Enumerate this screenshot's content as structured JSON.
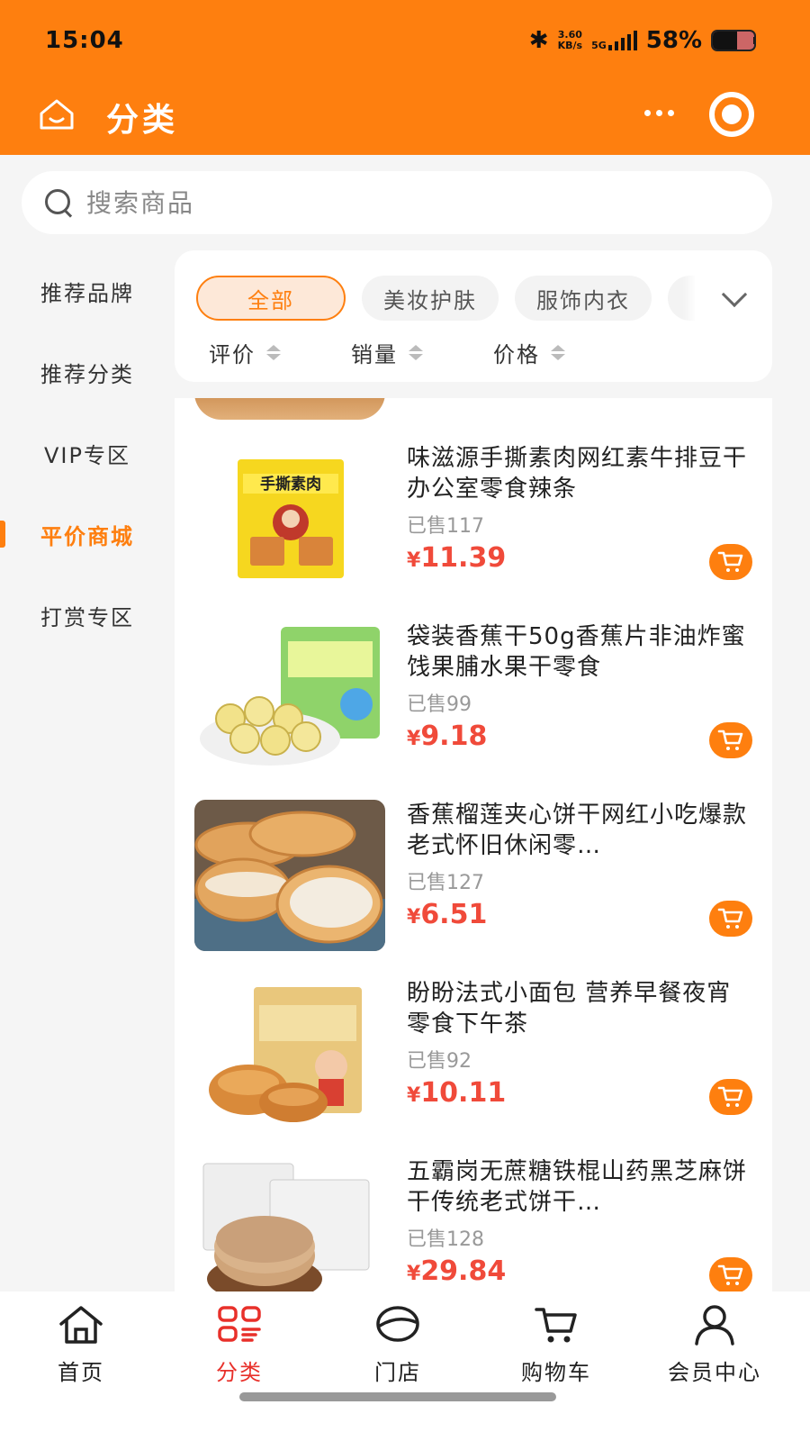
{
  "status_bar": {
    "time": "15:04",
    "network_speed_top": "3.60",
    "network_speed_bottom": "KB/s",
    "network_type": "5G",
    "battery_percent": "58%",
    "battery_level": 0.58
  },
  "header": {
    "title": "分类"
  },
  "search": {
    "placeholder": "搜索商品"
  },
  "sidebar": {
    "items": [
      {
        "label": "推荐品牌"
      },
      {
        "label": "推荐分类"
      },
      {
        "label": "VIP专区"
      },
      {
        "label": "平价商城"
      },
      {
        "label": "打赏专区"
      }
    ],
    "active": "平价商城"
  },
  "filter": {
    "chips": [
      {
        "label": "全部"
      },
      {
        "label": "美妆护肤"
      },
      {
        "label": "服饰内衣"
      }
    ],
    "sorts": [
      {
        "label": "评价"
      },
      {
        "label": "销量"
      },
      {
        "label": "价格"
      }
    ]
  },
  "products": [
    {
      "title": "味滋源手撕素肉网红素牛排豆干办公室零食辣条",
      "sold": "已售117",
      "currency": "¥",
      "price": "11.39",
      "image_icon": "vegetarian-meat-snack-image"
    },
    {
      "title": "袋装香蕉干50g香蕉片非油炸蜜饯果脯水果干零食",
      "sold": "已售99",
      "currency": "¥",
      "price": "9.18",
      "image_icon": "banana-chips-image"
    },
    {
      "title": "香蕉榴莲夹心饼干网红小吃爆款老式怀旧休闲零…",
      "sold": "已售127",
      "currency": "¥",
      "price": "6.51",
      "image_icon": "sandwich-biscuit-image"
    },
    {
      "title": "盼盼法式小面包 营养早餐夜宵零食下午茶",
      "sold": "已售92",
      "currency": "¥",
      "price": "10.11",
      "image_icon": "french-bread-image"
    },
    {
      "title": "五霸岗无蔗糖铁棍山药黑芝麻饼干传统老式饼干…",
      "sold": "已售128",
      "currency": "¥",
      "price": "29.84",
      "image_icon": "sesame-biscuit-image"
    }
  ],
  "bottom_nav": {
    "tabs": [
      {
        "label": "首页",
        "icon": "home-icon"
      },
      {
        "label": "分类",
        "icon": "category-icon"
      },
      {
        "label": "门店",
        "icon": "store-icon"
      },
      {
        "label": "购物车",
        "icon": "cart-icon"
      },
      {
        "label": "会员中心",
        "icon": "user-icon"
      }
    ],
    "active": "分类"
  },
  "colors": {
    "brand": "#fe7f0f",
    "price": "#f04a3a",
    "active_tab": "#e8302a"
  }
}
